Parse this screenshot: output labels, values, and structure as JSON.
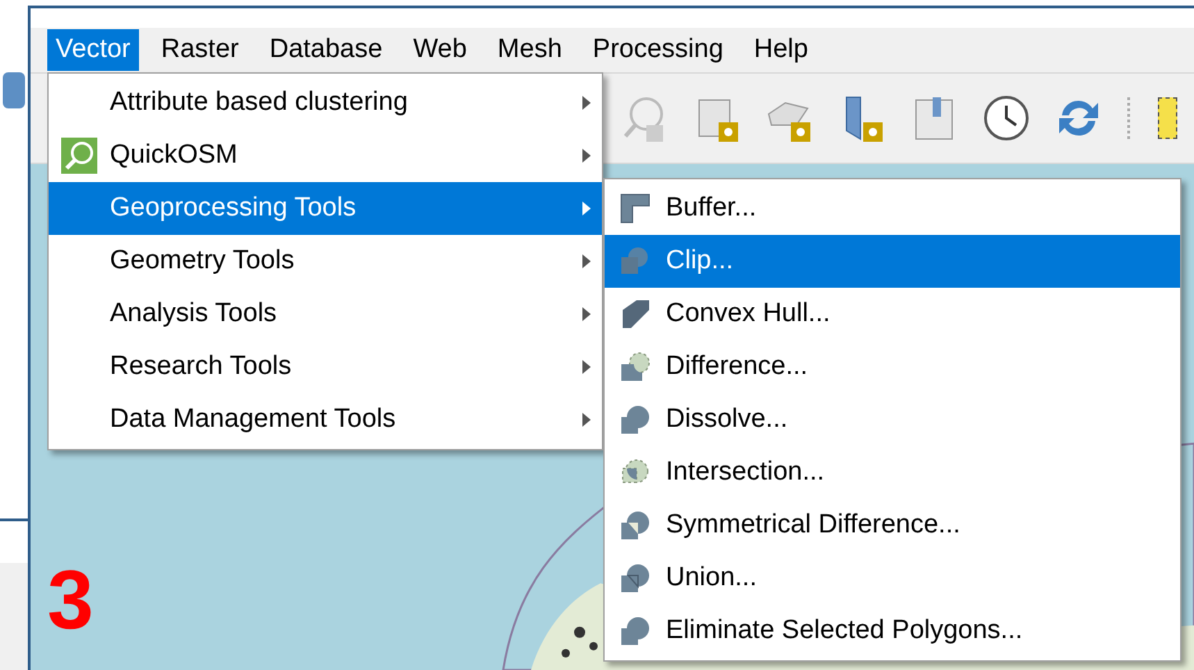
{
  "menu_bar": [
    {
      "label": "Vector",
      "selected": true
    },
    {
      "label": "Raster",
      "selected": false
    },
    {
      "label": "Database",
      "selected": false
    },
    {
      "label": "Web",
      "selected": false
    },
    {
      "label": "Mesh",
      "selected": false
    },
    {
      "label": "Processing",
      "selected": false
    },
    {
      "label": "Help",
      "selected": false
    }
  ],
  "vector_menu": [
    {
      "label": "Attribute based clustering",
      "selected": false,
      "has_icon": false
    },
    {
      "label": "QuickOSM",
      "selected": false,
      "has_icon": true
    },
    {
      "label": "Geoprocessing Tools",
      "selected": true,
      "has_icon": false
    },
    {
      "label": "Geometry Tools",
      "selected": false,
      "has_icon": false
    },
    {
      "label": "Analysis Tools",
      "selected": false,
      "has_icon": false
    },
    {
      "label": "Research Tools",
      "selected": false,
      "has_icon": false
    },
    {
      "label": "Data Management Tools",
      "selected": false,
      "has_icon": false
    }
  ],
  "geoprocessing_menu": [
    {
      "label": "Buffer...",
      "selected": false,
      "kind": "buffer"
    },
    {
      "label": "Clip...",
      "selected": true,
      "kind": "clip"
    },
    {
      "label": "Convex Hull...",
      "selected": false,
      "kind": "hull"
    },
    {
      "label": "Difference...",
      "selected": false,
      "kind": "difference"
    },
    {
      "label": "Dissolve...",
      "selected": false,
      "kind": "dissolve"
    },
    {
      "label": "Intersection...",
      "selected": false,
      "kind": "intersection"
    },
    {
      "label": "Symmetrical Difference...",
      "selected": false,
      "kind": "symdiff"
    },
    {
      "label": "Union...",
      "selected": false,
      "kind": "union"
    },
    {
      "label": "Eliminate Selected Polygons...",
      "selected": false,
      "kind": "dissolve"
    }
  ],
  "annotation": "3"
}
